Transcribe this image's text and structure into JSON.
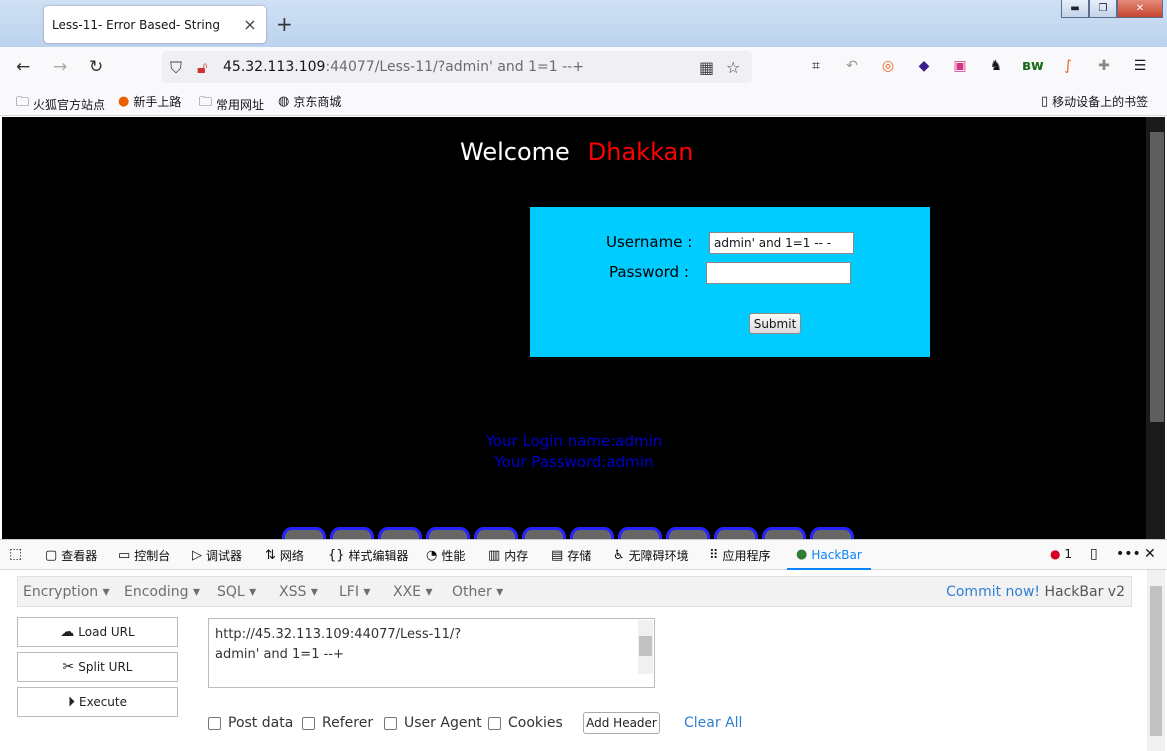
{
  "browser": {
    "tab_title": "Less-11- Error Based- String",
    "url_host": "45.32.113.109",
    "url_rest": ":44077/Less-11/?admin' and 1=1 --+",
    "window_buttons": {
      "minimize": "▬",
      "maximize": "❐",
      "close": "✕"
    }
  },
  "bookmarks": [
    {
      "label": "火狐官方站点",
      "icon": "folder-icon"
    },
    {
      "label": "新手上路",
      "icon": "firefox-icon"
    },
    {
      "label": "常用网址",
      "icon": "folder-icon"
    },
    {
      "label": "京东商城",
      "icon": "globe-icon"
    },
    {
      "label": "移动设备上的书签",
      "icon": "mobile-icon"
    }
  ],
  "page": {
    "welcome_label": "Welcome",
    "welcome_name": "Dhakkan",
    "username_label": "Username :",
    "username_value": "admin' and 1=1 -- -",
    "password_label": "Password :",
    "password_value": "",
    "submit_label": "Submit",
    "login_name_line": "Your Login name:admin",
    "password_line": "Your Password:admin"
  },
  "devtools": {
    "tabs": [
      {
        "label": "查看器",
        "icon": "inspector-icon"
      },
      {
        "label": "控制台",
        "icon": "console-icon"
      },
      {
        "label": "调试器",
        "icon": "debugger-icon"
      },
      {
        "label": "网络",
        "icon": "network-icon"
      },
      {
        "label": "样式编辑器",
        "icon": "style-editor-icon"
      },
      {
        "label": "性能",
        "icon": "performance-icon"
      },
      {
        "label": "内存",
        "icon": "memory-icon"
      },
      {
        "label": "存储",
        "icon": "storage-icon"
      },
      {
        "label": "无障碍环境",
        "icon": "accessibility-icon"
      },
      {
        "label": "应用程序",
        "icon": "application-icon"
      },
      {
        "label": "HackBar",
        "icon": "hackbar-icon"
      }
    ],
    "error_count": "1"
  },
  "hackbar": {
    "menus": [
      "Encryption",
      "Encoding",
      "SQL",
      "XSS",
      "LFI",
      "XXE",
      "Other"
    ],
    "commit_link": "Commit now!",
    "version": "HackBar v2",
    "load_url": "Load URL",
    "split_url": "Split URL",
    "execute": "Execute",
    "url_line1": "http://45.32.113.109:44077/Less-11/?",
    "url_line2": "admin' and 1=1 --+",
    "options": [
      "Post data",
      "Referer",
      "User Agent",
      "Cookies"
    ],
    "add_header": "Add Header",
    "clear_all": "Clear All"
  },
  "colors": {
    "login_box": "#00ccff",
    "name_red": "#ff0000",
    "result_blue": "#0000cc",
    "accent": "#0a84ff"
  }
}
